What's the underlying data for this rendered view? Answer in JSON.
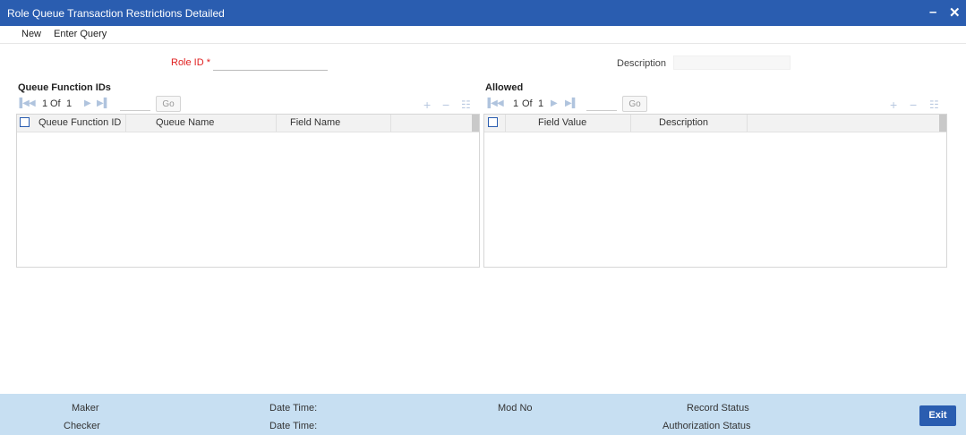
{
  "window": {
    "title": "Role Queue Transaction Restrictions Detailed",
    "minimize": "–",
    "close": "✕"
  },
  "menu": {
    "new": "New",
    "enter_query": "Enter Query"
  },
  "form": {
    "role_id_label": "Role ID",
    "required_mark": "*",
    "role_id_value": "",
    "description_label": "Description",
    "description_value": ""
  },
  "left_grid": {
    "title": "Queue Function IDs",
    "pager": {
      "page": "1",
      "of": "Of",
      "total": "1",
      "go": "Go"
    },
    "columns": [
      "Queue Function ID",
      "Queue Name",
      "Field Name"
    ],
    "rows": []
  },
  "right_grid": {
    "title": "Allowed",
    "pager": {
      "page": "1",
      "of": "Of",
      "total": "1",
      "go": "Go"
    },
    "columns": [
      "Field Value",
      "Description"
    ],
    "rows": []
  },
  "footer": {
    "maker": "Maker",
    "checker": "Checker",
    "date_time_1": "Date Time:",
    "date_time_2": "Date Time:",
    "mod_no": "Mod No",
    "record_status": "Record Status",
    "authorization_status": "Authorization Status",
    "exit": "Exit"
  },
  "colors": {
    "titlebar": "#2a5db0",
    "footer": "#c7dff2",
    "required": "#e02020",
    "exit_button": "#2a5db0"
  }
}
